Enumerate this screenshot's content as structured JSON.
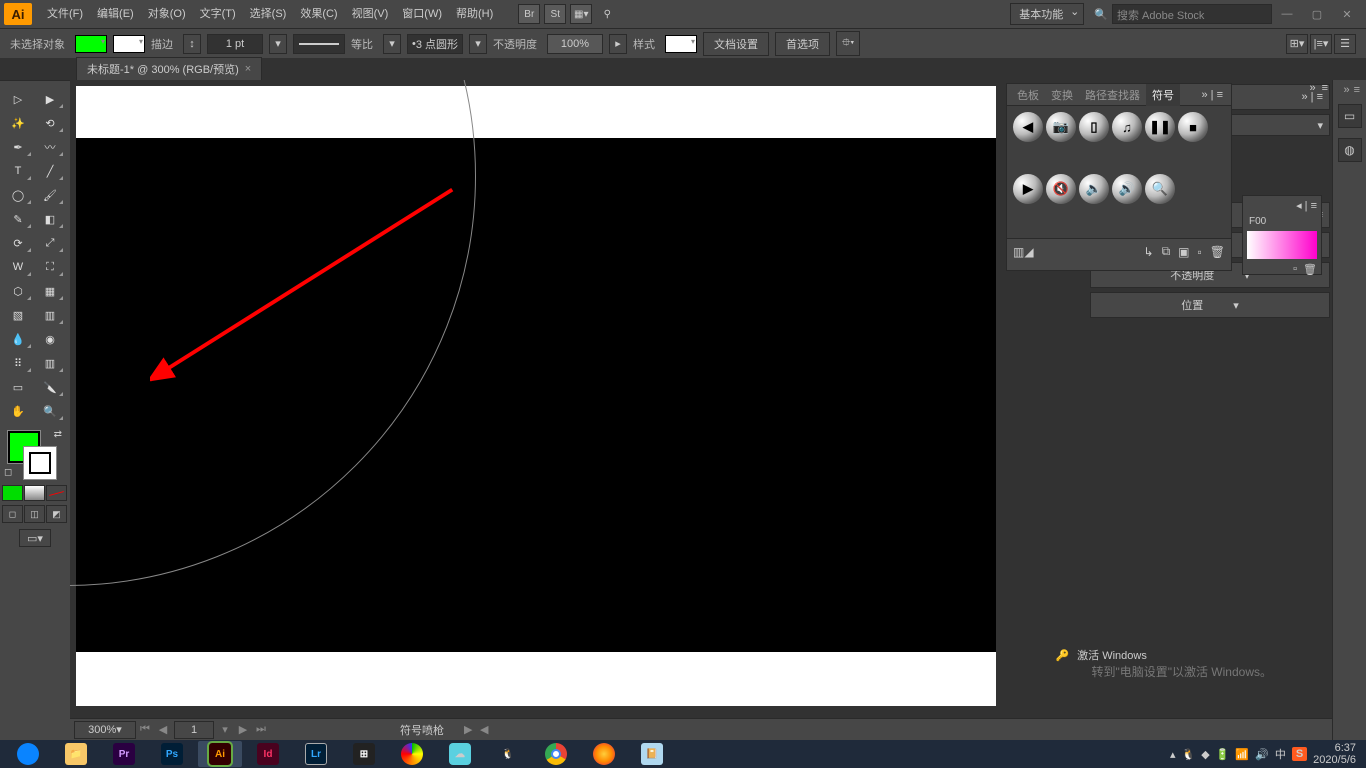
{
  "app": {
    "logo": "Ai"
  },
  "menu": {
    "file": "文件(F)",
    "edit": "编辑(E)",
    "object": "对象(O)",
    "text": "文字(T)",
    "select": "选择(S)",
    "effect": "效果(C)",
    "view": "视图(V)",
    "window": "窗口(W)",
    "help": "帮助(H)"
  },
  "topicons": {
    "br": "Br",
    "st": "St"
  },
  "workspace": {
    "label": "基本功能"
  },
  "search": {
    "placeholder": "搜索 Adobe Stock"
  },
  "ctrl": {
    "noSelection": "未选择对象",
    "stroke": "描边",
    "strokeVal": "1 pt",
    "brushLabel": "等比",
    "circles": "3 点圆形",
    "opacity": "不透明度",
    "opacityVal": "100%",
    "style": "样式",
    "docSetup": "文档设置",
    "prefs": "首选项"
  },
  "tab": {
    "title": "未标题-1* @ 300% (RGB/预览)"
  },
  "symbolsPanel": {
    "tabs": [
      "色板",
      "变换",
      "路径查找器",
      "符号"
    ],
    "activeTab": 3,
    "menuChevron": "»  |  ≡"
  },
  "colorHint": {
    "code": "F00"
  },
  "rpanelMeta": {
    "opacity": "不透明度",
    "position": "位置"
  },
  "status": {
    "zoom": "300%",
    "artboard": "1",
    "toolName": "符号喷枪"
  },
  "watermark": {
    "title": "激活 Windows",
    "sub": "转到\"电脑设置\"以激活 Windows。"
  },
  "tray": {
    "ime": "中",
    "s": "S",
    "time": "6:37",
    "date": "2020/5/6"
  }
}
